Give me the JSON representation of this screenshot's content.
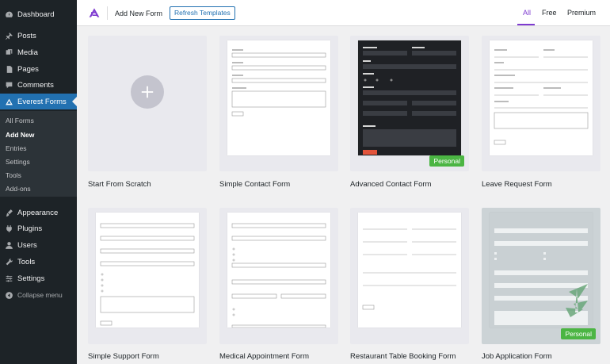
{
  "sidebar": {
    "items": [
      {
        "label": "Dashboard",
        "icon": "dashboard-icon"
      },
      {
        "label": "Posts",
        "icon": "pin-icon"
      },
      {
        "label": "Media",
        "icon": "media-icon"
      },
      {
        "label": "Pages",
        "icon": "pages-icon"
      },
      {
        "label": "Comments",
        "icon": "comments-icon"
      },
      {
        "label": "Everest Forms",
        "icon": "everest-forms-icon"
      },
      {
        "label": "Appearance",
        "icon": "brush-icon"
      },
      {
        "label": "Plugins",
        "icon": "plugin-icon"
      },
      {
        "label": "Users",
        "icon": "users-icon"
      },
      {
        "label": "Tools",
        "icon": "wrench-icon"
      },
      {
        "label": "Settings",
        "icon": "settings-icon"
      },
      {
        "label": "Collapse menu",
        "icon": "collapse-icon"
      }
    ],
    "submenu": [
      "All Forms",
      "Add New",
      "Entries",
      "Settings",
      "Tools",
      "Add-ons"
    ]
  },
  "header": {
    "title": "Add New Form",
    "refresh_label": "Refresh Templates",
    "tabs": [
      "All",
      "Free",
      "Premium"
    ]
  },
  "templates": [
    {
      "name": "Start From Scratch"
    },
    {
      "name": "Simple Contact Form"
    },
    {
      "name": "Advanced Contact Form",
      "badge": "Personal"
    },
    {
      "name": "Leave Request Form"
    },
    {
      "name": "Simple Support Form"
    },
    {
      "name": "Medical Appointment Form"
    },
    {
      "name": "Restaurant Table Booking Form"
    },
    {
      "name": "Job Application Form",
      "badge": "Personal"
    }
  ],
  "colors": {
    "sidebar_bg": "#1d2327",
    "active_blue": "#2271b1",
    "brand_purple": "#7e3bd0",
    "badge_green": "#4bb543"
  }
}
